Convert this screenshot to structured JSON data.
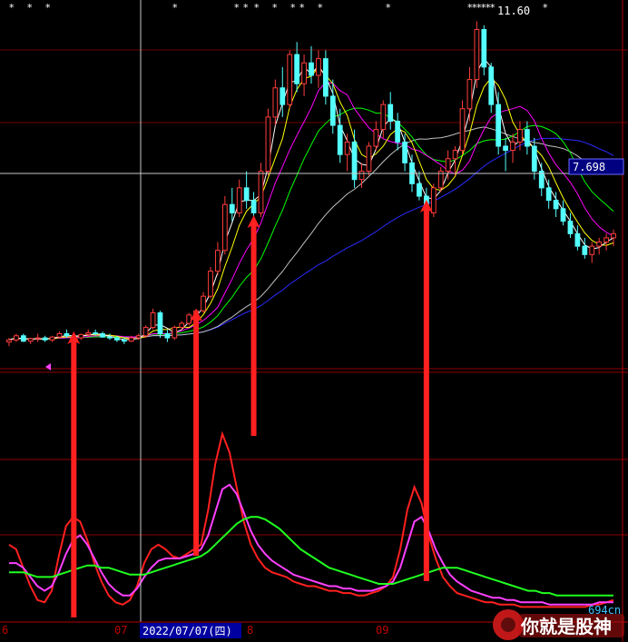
{
  "chart_data": [
    {
      "type": "candlestick",
      "title": "",
      "price_last_label": "7.698",
      "price_high_label": "11.60",
      "ma_colors": {
        "ma5": "#ffffff",
        "ma10": "#ffff00",
        "ma20": "#ff00ff",
        "ma30": "#00ff00",
        "ma60": "#c0c0c0",
        "ma120": "#2a2aff"
      },
      "up_color": "#ff3c3c",
      "down_color": "#54ffff",
      "dates_x_labels": [
        "6",
        "07",
        "8",
        "09"
      ],
      "crosshair_date": "2022/07/07(四)",
      "candles": [
        [
          3.9,
          4.0,
          3.8,
          3.95
        ],
        [
          3.95,
          4.1,
          3.9,
          4.05
        ],
        [
          4.05,
          4.1,
          3.9,
          3.92
        ],
        [
          3.92,
          4.0,
          3.85,
          3.98
        ],
        [
          3.98,
          4.1,
          3.9,
          4.0
        ],
        [
          4.0,
          4.05,
          3.9,
          3.95
        ],
        [
          3.95,
          4.05,
          3.9,
          4.02
        ],
        [
          4.02,
          4.15,
          4.0,
          4.1
        ],
        [
          4.1,
          4.2,
          4.0,
          4.05
        ],
        [
          4.05,
          4.1,
          3.95,
          4.0
        ],
        [
          4.0,
          4.1,
          3.95,
          4.08
        ],
        [
          4.08,
          4.2,
          4.0,
          4.12
        ],
        [
          4.12,
          4.2,
          4.05,
          4.1
        ],
        [
          4.1,
          4.15,
          4.0,
          4.02
        ],
        [
          4.02,
          4.1,
          3.95,
          4.0
        ],
        [
          4.0,
          4.05,
          3.9,
          3.95
        ],
        [
          3.95,
          4.0,
          3.85,
          3.92
        ],
        [
          3.92,
          4.05,
          3.9,
          4.0
        ],
        [
          4.0,
          4.1,
          3.95,
          4.05
        ],
        [
          4.05,
          4.3,
          4.0,
          4.25
        ],
        [
          4.25,
          4.7,
          4.2,
          4.6
        ],
        [
          4.6,
          4.65,
          4.0,
          4.1
        ],
        [
          4.1,
          4.2,
          3.9,
          4.0
        ],
        [
          4.0,
          4.3,
          3.95,
          4.25
        ],
        [
          4.25,
          4.4,
          4.2,
          4.35
        ],
        [
          4.35,
          4.6,
          4.3,
          4.55
        ],
        [
          4.55,
          4.7,
          4.45,
          4.65
        ],
        [
          4.65,
          5.1,
          4.6,
          5.0
        ],
        [
          5.0,
          5.7,
          4.95,
          5.6
        ],
        [
          5.6,
          6.3,
          5.5,
          6.1
        ],
        [
          6.1,
          7.4,
          6.0,
          7.2
        ],
        [
          7.2,
          7.6,
          6.8,
          7.0
        ],
        [
          7.0,
          7.8,
          6.9,
          7.6
        ],
        [
          7.6,
          8.0,
          7.1,
          7.3
        ],
        [
          7.3,
          7.5,
          6.8,
          7.0
        ],
        [
          7.0,
          8.2,
          6.9,
          8.0
        ],
        [
          8.0,
          9.5,
          7.9,
          9.3
        ],
        [
          9.3,
          10.2,
          9.1,
          10.0
        ],
        [
          10.0,
          10.5,
          9.3,
          9.6
        ],
        [
          9.6,
          10.9,
          9.5,
          10.8
        ],
        [
          10.8,
          11.1,
          9.9,
          10.1
        ],
        [
          10.1,
          10.8,
          9.8,
          10.6
        ],
        [
          10.6,
          11.0,
          10.1,
          10.3
        ],
        [
          10.3,
          10.9,
          10.0,
          10.7
        ],
        [
          10.7,
          10.9,
          9.6,
          9.8
        ],
        [
          9.8,
          10.2,
          8.9,
          9.1
        ],
        [
          9.1,
          9.5,
          8.2,
          8.4
        ],
        [
          8.4,
          8.9,
          8.0,
          8.7
        ],
        [
          8.7,
          9.0,
          7.6,
          7.8
        ],
        [
          7.8,
          8.2,
          7.6,
          8.0
        ],
        [
          8.0,
          8.7,
          7.9,
          8.6
        ],
        [
          8.6,
          9.2,
          8.5,
          9.0
        ],
        [
          9.0,
          9.7,
          8.8,
          9.6
        ],
        [
          9.6,
          9.9,
          9.0,
          9.2
        ],
        [
          9.2,
          9.4,
          8.5,
          8.7
        ],
        [
          8.7,
          8.9,
          8.0,
          8.2
        ],
        [
          8.2,
          8.4,
          7.5,
          7.7
        ],
        [
          7.7,
          8.0,
          7.3,
          7.4
        ],
        [
          7.4,
          7.6,
          6.8,
          7.0
        ],
        [
          7.0,
          7.7,
          6.9,
          7.6
        ],
        [
          7.6,
          8.1,
          7.5,
          8.0
        ],
        [
          8.0,
          8.5,
          7.8,
          8.3
        ],
        [
          8.3,
          8.6,
          7.9,
          8.5
        ],
        [
          8.5,
          9.7,
          8.4,
          9.5
        ],
        [
          9.5,
          10.5,
          9.2,
          10.2
        ],
        [
          10.2,
          11.6,
          10.0,
          11.4
        ],
        [
          11.4,
          11.5,
          10.3,
          10.5
        ],
        [
          10.5,
          10.6,
          9.4,
          9.6
        ],
        [
          9.6,
          9.9,
          8.4,
          8.6
        ],
        [
          8.6,
          8.8,
          8.0,
          8.5
        ],
        [
          8.5,
          8.9,
          8.2,
          8.7
        ],
        [
          8.7,
          9.2,
          8.5,
          9.0
        ],
        [
          9.0,
          9.2,
          8.4,
          8.6
        ],
        [
          8.6,
          8.8,
          7.8,
          8.0
        ],
        [
          8.0,
          8.2,
          7.4,
          7.6
        ],
        [
          7.6,
          7.8,
          7.1,
          7.3
        ],
        [
          7.3,
          7.5,
          6.9,
          7.1
        ],
        [
          7.1,
          7.3,
          6.7,
          6.8
        ],
        [
          6.8,
          7.0,
          6.4,
          6.5
        ],
        [
          6.5,
          6.7,
          6.1,
          6.2
        ],
        [
          6.2,
          6.4,
          5.9,
          6.0
        ],
        [
          6.0,
          6.3,
          5.8,
          6.2
        ],
        [
          6.2,
          6.4,
          6.0,
          6.3
        ],
        [
          6.3,
          6.5,
          6.1,
          6.4
        ],
        [
          6.4,
          6.6,
          6.2,
          6.5
        ]
      ],
      "ylim": [
        3.5,
        12.0
      ]
    },
    {
      "type": "line",
      "title": "",
      "ylim": [
        0,
        100
      ],
      "series": [
        {
          "color": "#ff2020",
          "values": [
            30,
            28,
            20,
            12,
            6,
            5,
            10,
            25,
            38,
            42,
            40,
            32,
            22,
            14,
            8,
            5,
            4,
            6,
            12,
            22,
            28,
            30,
            28,
            25,
            24,
            26,
            28,
            30,
            45,
            65,
            78,
            70,
            55,
            40,
            30,
            24,
            20,
            18,
            17,
            16,
            14,
            13,
            12,
            12,
            11,
            10,
            10,
            9,
            9,
            8,
            8,
            9,
            10,
            12,
            16,
            28,
            45,
            55,
            48,
            34,
            24,
            16,
            12,
            9,
            8,
            7,
            6,
            5,
            5,
            4,
            4,
            4,
            3,
            3,
            3,
            3,
            3,
            3,
            3,
            3,
            3,
            3,
            4,
            4,
            5,
            6
          ]
        },
        {
          "color": "#ff40ff",
          "values": [
            22,
            22,
            20,
            16,
            12,
            10,
            12,
            18,
            26,
            32,
            34,
            30,
            24,
            18,
            13,
            10,
            8,
            8,
            11,
            16,
            20,
            23,
            24,
            24,
            24,
            25,
            26,
            28,
            34,
            44,
            54,
            56,
            52,
            44,
            36,
            30,
            26,
            23,
            21,
            19,
            17,
            16,
            15,
            14,
            13,
            12,
            12,
            11,
            11,
            10,
            10,
            10,
            11,
            12,
            14,
            20,
            30,
            40,
            42,
            36,
            28,
            22,
            17,
            14,
            12,
            10,
            9,
            8,
            7,
            7,
            6,
            6,
            5,
            5,
            5,
            5,
            4,
            4,
            4,
            4,
            4,
            4,
            4,
            5,
            5,
            5
          ]
        },
        {
          "color": "#20ff20",
          "values": [
            18,
            18,
            18,
            17,
            16,
            16,
            16,
            17,
            18,
            19,
            20,
            21,
            21,
            20,
            20,
            19,
            18,
            17,
            17,
            17,
            18,
            19,
            20,
            21,
            22,
            23,
            24,
            25,
            27,
            30,
            33,
            36,
            39,
            41,
            42,
            42,
            41,
            39,
            37,
            34,
            31,
            28,
            26,
            24,
            22,
            20,
            19,
            18,
            17,
            16,
            15,
            14,
            13,
            13,
            13,
            14,
            15,
            16,
            17,
            18,
            19,
            20,
            20,
            20,
            19,
            18,
            17,
            16,
            15,
            14,
            13,
            12,
            11,
            10,
            10,
            9,
            9,
            8,
            8,
            8,
            8,
            8,
            8,
            8,
            8,
            8
          ]
        }
      ]
    }
  ],
  "labels": {
    "date_ticks": [
      "6",
      "07",
      "8",
      "09"
    ],
    "crosshair_date": "2022/07/07(四)",
    "price_tag": "7.698",
    "high_tag": "11.60",
    "bottom_right_value": "694cn",
    "watermark": "你就是股神"
  },
  "colors": {
    "background": "#000000",
    "grid": "#8b0000",
    "axis_red": "#b00000",
    "price_tag_bg": "#000080",
    "date_box_bg": "#0000a0",
    "arrow": "#ff2020"
  }
}
